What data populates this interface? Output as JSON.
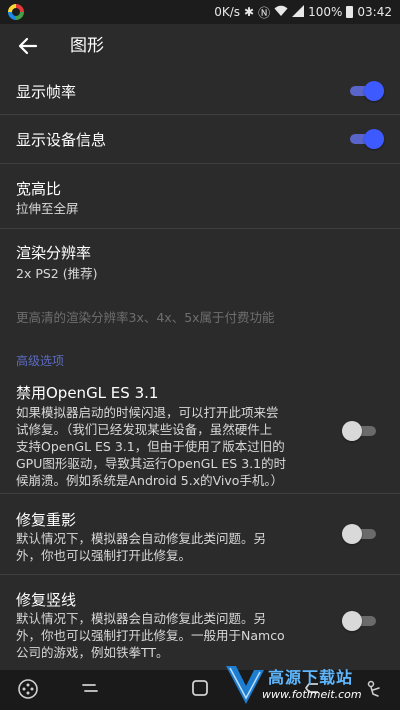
{
  "status_bar": {
    "network_speed": "0K/s",
    "battery_percent": "100%",
    "time": "03:42",
    "icons": [
      "bluetooth-icon",
      "nfc-icon",
      "wifi-icon",
      "signal-icon",
      "battery-icon"
    ]
  },
  "toolbar": {
    "title": "图形",
    "back_icon": "arrow-left-icon"
  },
  "settings": {
    "show_fps": {
      "title": "显示帧率",
      "enabled": true
    },
    "show_device_info": {
      "title": "显示设备信息",
      "enabled": true
    },
    "aspect_ratio": {
      "title": "宽高比",
      "value": "拉伸至全屏"
    },
    "render_resolution": {
      "title": "渲染分辨率",
      "value": "2x PS2 (推荐)",
      "note": "更高清的渲染分辨率3x、4x、5x属于付费功能"
    },
    "advanced_header": "高级选项",
    "disable_opengl": {
      "title": "禁用OpenGL ES 3.1",
      "lines": [
        "如果模拟器启动的时候闪退，可以打开此项来尝",
        "试修复。（我们已经发现某些设备，虽然硬件上",
        "支持OpenGL ES 3.1，但由于使用了版本过旧的",
        "GPU图形驱动，导致其运行OpenGL ES 3.1的时",
        "候崩溃。例如系统是Android 5.x的Vivo手机。）"
      ],
      "enabled": false
    },
    "fix_ghosting": {
      "title": "修复重影",
      "lines": [
        "默认情况下，模拟器会自动修复此类问题。另",
        "外，你也可以强制打开此修复。"
      ],
      "enabled": false
    },
    "fix_vertical_lines": {
      "title": "修复竖线",
      "lines": [
        "默认情况下，模拟器会自动修复此类问题。另",
        "外，你也可以强制打开此修复。一般用于Namco",
        "公司的游戏，例如铁拳TT。"
      ],
      "enabled": false
    }
  },
  "nav_bar": {
    "icons": [
      "gamepad-icon",
      "recent-apps-icon",
      "home-icon",
      "back-icon",
      "assist-icon"
    ]
  },
  "watermark": {
    "title": "高源下载站",
    "url": "www.fotimeit.com"
  },
  "colors": {
    "background": "#2b2b2b",
    "accent": "#3d5afe",
    "section_header": "#5c6bc0",
    "disabled_text": "#6e6e6e"
  }
}
